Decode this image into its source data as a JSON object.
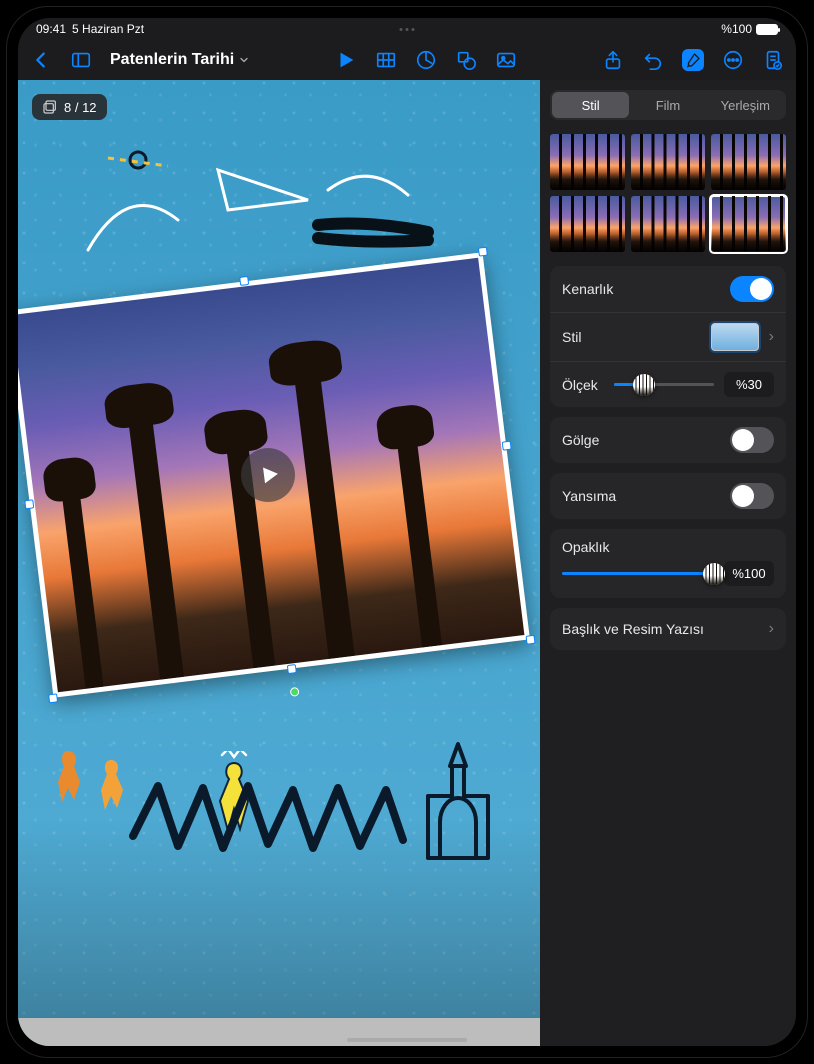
{
  "status": {
    "time": "09:41",
    "date": "5 Haziran Pzt",
    "battery_pct": "%100"
  },
  "toolbar": {
    "doc_title": "Patenlerin Tarihi"
  },
  "canvas": {
    "slide_counter": "8 / 12"
  },
  "inspector": {
    "tabs": {
      "style": "Stil",
      "movie": "Film",
      "arrange": "Yerleşim"
    },
    "style_thumbs": 6,
    "selected_thumb_index": 5,
    "border": {
      "label": "Kenarlık",
      "on": true
    },
    "style_row": {
      "label": "Stil"
    },
    "scale": {
      "label": "Ölçek",
      "value_text": "%30",
      "value_pct": 30
    },
    "shadow": {
      "label": "Gölge",
      "on": false
    },
    "reflection": {
      "label": "Yansıma",
      "on": false
    },
    "opacity": {
      "label": "Opaklık",
      "value_text": "%100",
      "value_pct": 100
    },
    "caption": {
      "label": "Başlık ve Resim Yazısı"
    }
  }
}
